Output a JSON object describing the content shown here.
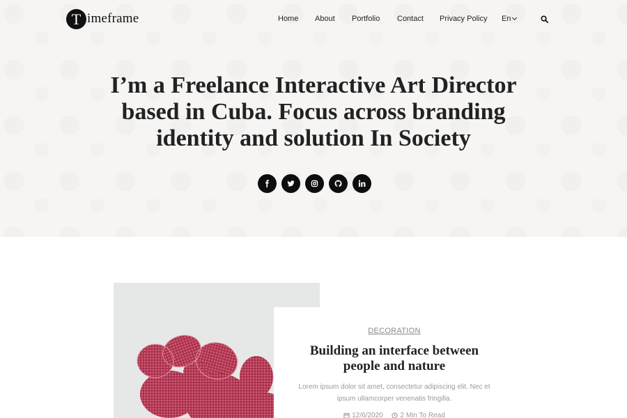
{
  "brand": {
    "mark": "T",
    "text": "imeframe"
  },
  "nav": {
    "items": [
      "Home",
      "About",
      "Portfolio",
      "Contact",
      "Privacy Policy"
    ],
    "language": "En"
  },
  "icons": {
    "search": "search-icon",
    "language_dropdown": "chevron-down-icon"
  },
  "hero": {
    "headline": "I’m a Freelance Interactive Art Director based in Cuba. Focus across branding identity and solution In Society",
    "socials": [
      "facebook-icon",
      "twitter-icon",
      "instagram-icon",
      "github-icon",
      "linkedin-icon"
    ]
  },
  "post": {
    "category": "DECORATION",
    "title": "Building an interface between people and nature",
    "excerpt": "Lorem ipsum dolor sit amet, consectetur adipiscing elit. Nec et ipsum ullamcorper venenatis fringilla.",
    "date": "12/6/2020",
    "read_time": "2 Min To Read"
  },
  "colors": {
    "hero_bg": "#f6f5f4",
    "dark": "#0d0d0d",
    "muted_text": "#9a9a9a",
    "cactus": "#b83a55"
  }
}
